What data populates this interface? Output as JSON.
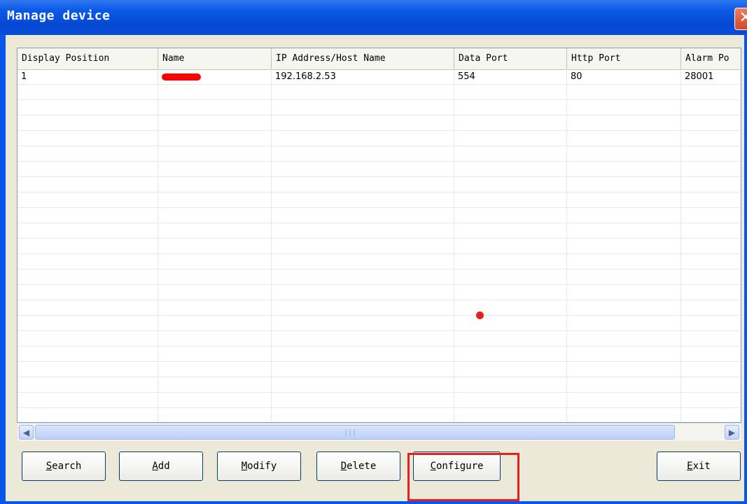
{
  "window": {
    "title": "Manage device",
    "close_glyph": "✕"
  },
  "table": {
    "columns": [
      "Display Position",
      "Name",
      "IP Address/Host Name",
      "Data Port",
      "Http Port",
      "Alarm Po"
    ],
    "rows": [
      {
        "position": "1",
        "name": "",
        "ip": "192.168.2.53",
        "data_port": "554",
        "http_port": "80",
        "alarm_port": "28001"
      }
    ]
  },
  "scrollbar": {
    "left_glyph": "◀",
    "right_glyph": "▶",
    "grip": "|||"
  },
  "buttons": {
    "search": "Search",
    "add": "Add",
    "modify": "Modify",
    "delete": "Delete",
    "configure": "Configure",
    "exit": "Exit"
  },
  "colors": {
    "titlebar": "#0a55ea",
    "highlight": "#e8201c",
    "redaction": "#ff0000"
  },
  "icons": {
    "close": "close-icon",
    "scroll_left": "chevron-left-icon",
    "scroll_right": "chevron-right-icon"
  }
}
